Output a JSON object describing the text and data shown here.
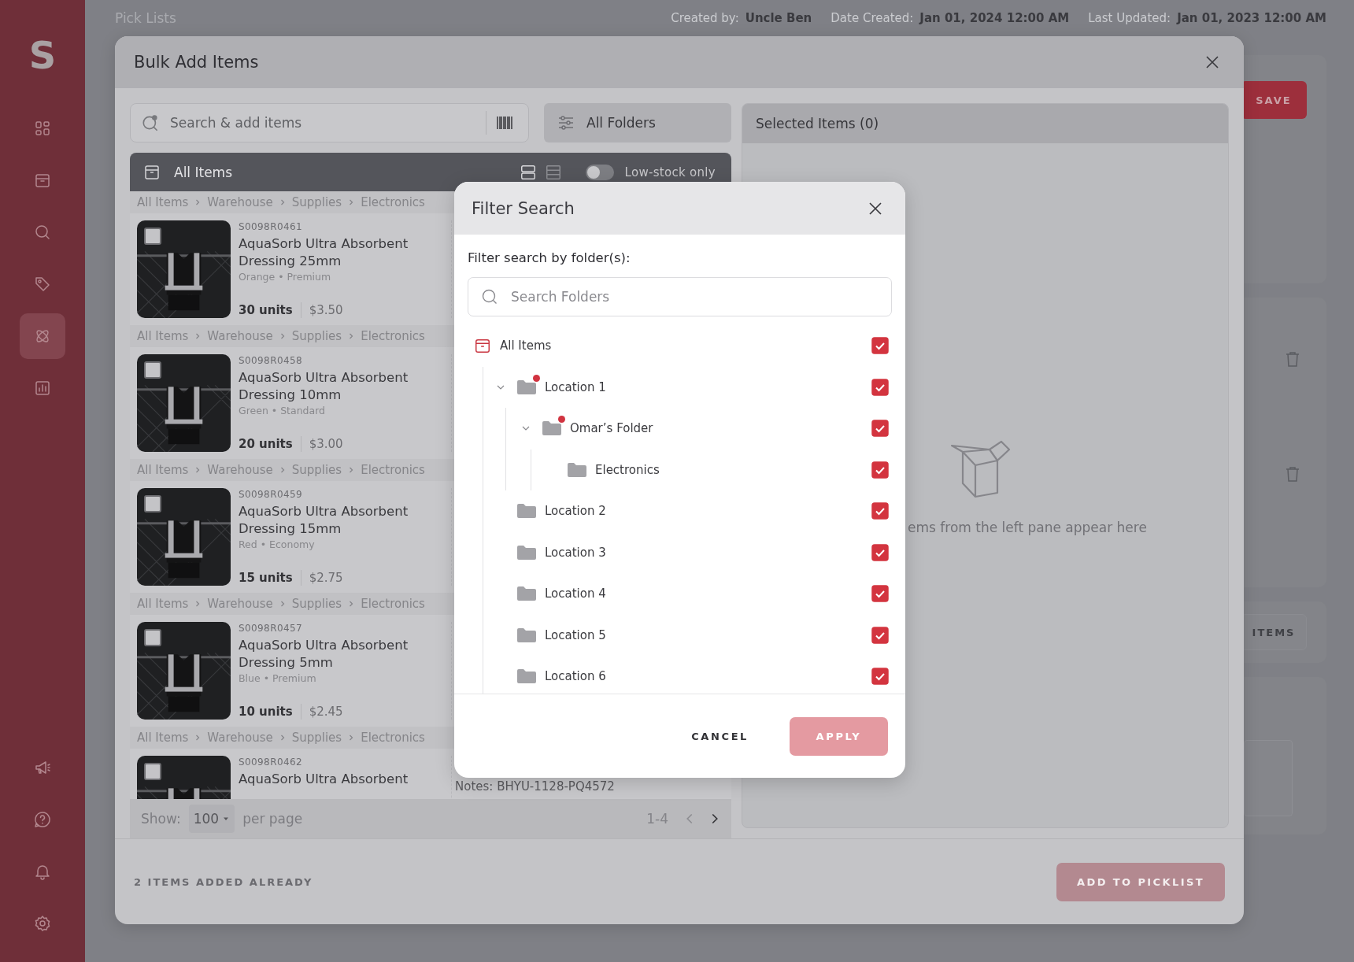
{
  "page": {
    "title": "Pick Lists",
    "meta": [
      {
        "label": "Created by:",
        "value": "Uncle Ben"
      },
      {
        "label": "Date Created:",
        "value": "Jan 01, 2024 12:00 AM"
      },
      {
        "label": "Last Updated:",
        "value": "Jan 01, 2023 12:00 AM"
      }
    ],
    "save_button": "SAVE",
    "items_button": "ITEMS"
  },
  "sidebar": {
    "logo": "S",
    "items": [
      {
        "selected": false
      },
      {
        "selected": false
      },
      {
        "selected": false
      },
      {
        "selected": false
      },
      {
        "selected": true
      },
      {
        "selected": false
      }
    ],
    "bottom_items": [
      {
        "selected": false
      },
      {
        "selected": false
      },
      {
        "selected": false
      },
      {
        "selected": false
      }
    ]
  },
  "bulk_add": {
    "title": "Bulk Add Items",
    "search": {
      "placeholder": "Search & add items"
    },
    "folder_button": "All Folders",
    "list_title": "All Items",
    "view_modes": [
      {
        "selected": true
      },
      {
        "selected": false
      }
    ],
    "low_stock": {
      "label": "Low-stock only",
      "on": false
    },
    "items": [
      {
        "breadcrumb": [
          "All Items",
          "Warehouse",
          "Supplies",
          "Electronics"
        ],
        "sku": "S0098R0461",
        "name": "AquaSorb Ultra Absorbent Dressing 25mm",
        "variant": "Orange • Premium",
        "units": "30 units",
        "price": "$3.50",
        "checked": false
      },
      {
        "breadcrumb": [
          "All Items",
          "Warehouse",
          "Supplies",
          "Electronics"
        ],
        "sku": "S0098R0458",
        "name": "AquaSorb Ultra Absorbent Dressing 10mm",
        "variant": "Green • Standard",
        "units": "20 units",
        "price": "$3.00",
        "checked": false
      },
      {
        "breadcrumb": [
          "All Items",
          "Warehouse",
          "Supplies",
          "Electronics"
        ],
        "sku": "S0098R0459",
        "name": "AquaSorb Ultra Absorbent Dressing 15mm",
        "variant": "Red • Economy",
        "units": "15 units",
        "price": "$2.75",
        "checked": false
      },
      {
        "breadcrumb": [
          "All Items",
          "Warehouse",
          "Supplies",
          "Electronics"
        ],
        "sku": "S0098R0457",
        "name": "AquaSorb Ultra Absorbent Dressing 5mm",
        "variant": "Blue • Premium",
        "units": "10 units",
        "price": "$2.45",
        "checked": false
      },
      {
        "breadcrumb": [
          "All Items",
          "Warehouse",
          "Supplies",
          "Electronics"
        ],
        "sku": "S0098R0462",
        "name": "AquaSorb Ultra Absorbent",
        "notes": "Notes: BHYU-1128-PQ4572",
        "checked": false
      }
    ],
    "pagination": {
      "show_label": "Show:",
      "per_page": "100",
      "per_page_label": "per page",
      "range": "1-4"
    },
    "selected_title": "Selected Items (0)",
    "empty_text": "ems from the left pane appear here",
    "footer_note": "2 ITEMS ADDED ALREADY",
    "add_button": {
      "label": "ADD TO PICKLIST",
      "disabled": true
    }
  },
  "filter_dialog": {
    "title": "Filter Search",
    "prompt": "Filter search by folder(s):",
    "search": {
      "placeholder": "Search Folders"
    },
    "folders": [
      {
        "label": "All Items",
        "kind": "root",
        "checked": true,
        "indicator": false,
        "children": [
          {
            "label": "Location 1",
            "kind": "folder",
            "checked": true,
            "expanded": true,
            "indicator": true,
            "children": [
              {
                "label": "Omar’s Folder",
                "kind": "folder",
                "checked": true,
                "expanded": true,
                "indicator": true,
                "children": [
                  {
                    "label": "Electronics",
                    "kind": "folder",
                    "checked": true,
                    "indicator": false
                  }
                ]
              }
            ]
          },
          {
            "label": "Location 2",
            "kind": "folder",
            "checked": true,
            "indicator": false
          },
          {
            "label": "Location 3",
            "kind": "folder",
            "checked": true,
            "indicator": false
          },
          {
            "label": "Location 4",
            "kind": "folder",
            "checked": true,
            "indicator": false
          },
          {
            "label": "Location 5",
            "kind": "folder",
            "checked": true,
            "indicator": false
          },
          {
            "label": "Location 6",
            "kind": "folder",
            "checked": true,
            "indicator": false
          }
        ]
      }
    ],
    "cancel": "CANCEL",
    "apply": {
      "label": "APPLY",
      "disabled": true
    }
  }
}
